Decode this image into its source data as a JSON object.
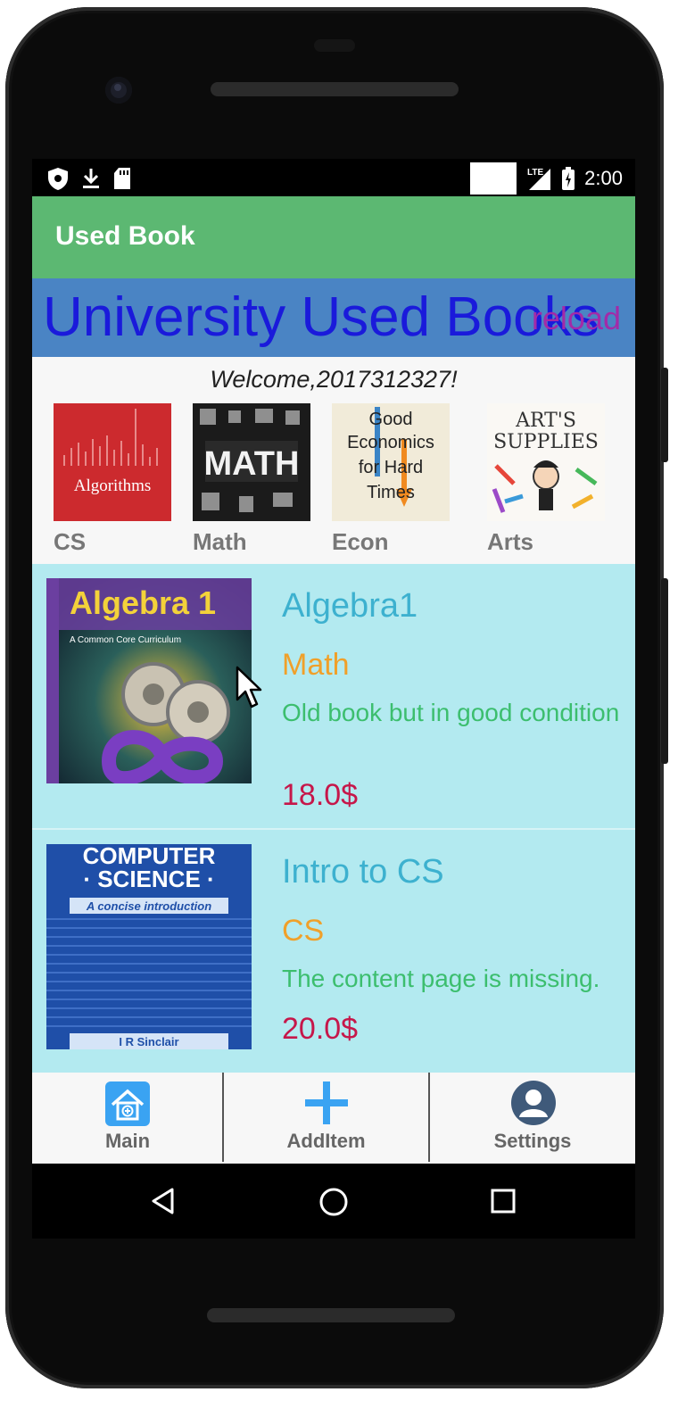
{
  "status_bar": {
    "time": "2:00",
    "network": "LTE",
    "icons": [
      "shield-icon",
      "download-icon",
      "sd-card-icon",
      "signal-icon",
      "battery-icon"
    ]
  },
  "app_bar": {
    "title": "Used Book"
  },
  "banner": {
    "title": "University Used Books",
    "reload_label": "reload"
  },
  "welcome": {
    "text": "Welcome,2017312327!"
  },
  "categories": [
    {
      "label": "CS",
      "cover_text": "Algorithms"
    },
    {
      "label": "Math",
      "cover_text": "MATH"
    },
    {
      "label": "Econ",
      "cover_text": "Good Economics for Hard Times"
    },
    {
      "label": "Arts",
      "cover_text": "ART SUPPLIES"
    }
  ],
  "books": [
    {
      "title": "Algebra1",
      "category": "Math",
      "description": "Old book but in good condition",
      "price": "18.0$",
      "cover_title": "Algebra 1",
      "cover_subtitle": "A Common Core Curriculum"
    },
    {
      "title": "Intro to CS",
      "category": "CS",
      "description": "The content page is missing.",
      "price": "20.0$",
      "cover_title": "COMPUTER SCIENCE",
      "cover_subtitle": "A concise introduction",
      "cover_author": "I R Sinclair"
    }
  ],
  "bottom_nav": {
    "main_label": "Main",
    "add_label": "AddItem",
    "settings_label": "Settings"
  },
  "colors": {
    "app_bar": "#5cb872",
    "banner": "#4a84c4",
    "banner_text": "#1a1adb",
    "reload": "#a32aa8",
    "list_bg": "#b3eaf0",
    "title": "#3db1cf",
    "category": "#f0a02a",
    "description": "#3cbe6e",
    "price": "#c6174a"
  }
}
